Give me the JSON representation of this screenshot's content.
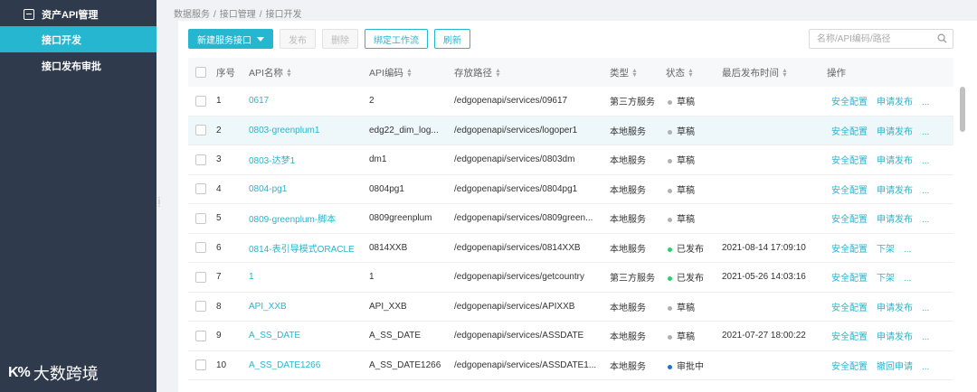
{
  "sidebar": {
    "items": [
      {
        "label": "资产API管理",
        "icon": "asset-icon"
      },
      {
        "label": "接口开发",
        "active": true
      },
      {
        "label": "接口发布审批"
      }
    ]
  },
  "logo": {
    "mark": "K%",
    "text": "大数跨境"
  },
  "breadcrumb": [
    "数据服务",
    "/",
    "接口管理",
    "/",
    "接口开发"
  ],
  "toolbar": {
    "new_label": "新建服务接口",
    "publish_label": "发布",
    "delete_label": "删除",
    "bind_label": "绑定工作流",
    "refresh_label": "刷新"
  },
  "search": {
    "placeholder": "名称/API编码/路径"
  },
  "colors": {
    "accent": "#26b6cf",
    "sidebar": "#2f3a4c",
    "draft": "#b0b0b0",
    "published": "#2ecc71",
    "reviewing": "#1e6fd9"
  },
  "table": {
    "headers": {
      "index": "序号",
      "name": "API名称",
      "code": "API编码",
      "path": "存放路径",
      "type": "类型",
      "status": "状态",
      "time": "最后发布时间",
      "ops": "操作"
    },
    "rows": [
      {
        "index": "1",
        "name": "0617",
        "code": "2",
        "path": "/edgopenapi/services/09617",
        "type": "第三方服务",
        "status": "草稿",
        "status_color": "#b0b0b0",
        "time": "",
        "op1": "安全配置",
        "op2": "申请发布",
        "more": "..."
      },
      {
        "index": "2",
        "name": "0803-greenplum1",
        "code": "edg22_dim_log...",
        "path": "/edgopenapi/services/logoper1",
        "type": "本地服务",
        "status": "草稿",
        "status_color": "#b0b0b0",
        "time": "",
        "op1": "安全配置",
        "op2": "申请发布",
        "more": "..."
      },
      {
        "index": "3",
        "name": "0803-达梦1",
        "code": "dm1",
        "path": "/edgopenapi/services/0803dm",
        "type": "本地服务",
        "status": "草稿",
        "status_color": "#b0b0b0",
        "time": "",
        "op1": "安全配置",
        "op2": "申请发布",
        "more": "..."
      },
      {
        "index": "4",
        "name": "0804-pg1",
        "code": "0804pg1",
        "path": "/edgopenapi/services/0804pg1",
        "type": "本地服务",
        "status": "草稿",
        "status_color": "#b0b0b0",
        "time": "",
        "op1": "安全配置",
        "op2": "申请发布",
        "more": "..."
      },
      {
        "index": "5",
        "name": "0809-greenplum-脚本",
        "code": "0809greenplum",
        "path": "/edgopenapi/services/0809green...",
        "type": "本地服务",
        "status": "草稿",
        "status_color": "#b0b0b0",
        "time": "",
        "op1": "安全配置",
        "op2": "申请发布",
        "more": "..."
      },
      {
        "index": "6",
        "name": "0814-表引导模式ORACLE",
        "code": "0814XXB",
        "path": "/edgopenapi/services/0814XXB",
        "type": "本地服务",
        "status": "已发布",
        "status_color": "#2ecc71",
        "time": "2021-08-14 17:09:10",
        "op1": "安全配置",
        "op2": "下架",
        "more": "..."
      },
      {
        "index": "7",
        "name": "1",
        "code": "1",
        "path": "/edgopenapi/services/getcountry",
        "type": "第三方服务",
        "status": "已发布",
        "status_color": "#2ecc71",
        "time": "2021-05-26 14:03:16",
        "op1": "安全配置",
        "op2": "下架",
        "more": "..."
      },
      {
        "index": "8",
        "name": "API_XXB",
        "code": "API_XXB",
        "path": "/edgopenapi/services/APIXXB",
        "type": "本地服务",
        "status": "草稿",
        "status_color": "#b0b0b0",
        "time": "",
        "op1": "安全配置",
        "op2": "申请发布",
        "more": "..."
      },
      {
        "index": "9",
        "name": "A_SS_DATE",
        "code": "A_SS_DATE",
        "path": "/edgopenapi/services/ASSDATE",
        "type": "本地服务",
        "status": "草稿",
        "status_color": "#b0b0b0",
        "time": "2021-07-27 18:00:22",
        "op1": "安全配置",
        "op2": "申请发布",
        "more": "..."
      },
      {
        "index": "10",
        "name": "A_SS_DATE1266",
        "code": "A_SS_DATE1266",
        "path": "/edgopenapi/services/ASSDATE1...",
        "type": "本地服务",
        "status": "审批中",
        "status_color": "#1e6fd9",
        "time": "",
        "op1": "安全配置",
        "op2": "撤回申请",
        "more": "..."
      }
    ]
  }
}
